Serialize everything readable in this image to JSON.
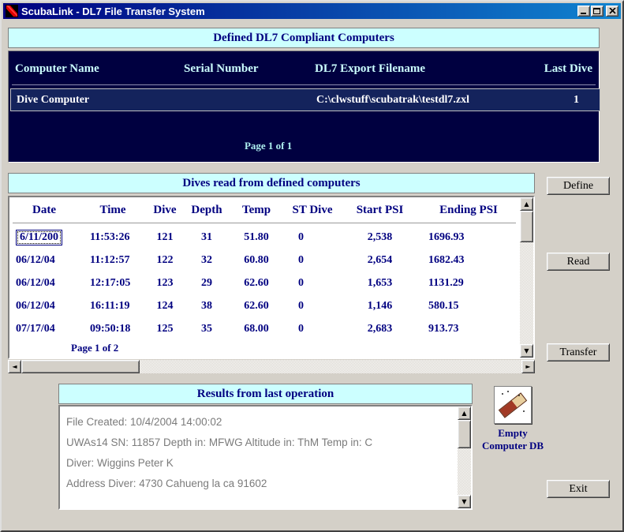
{
  "window": {
    "title": "ScubaLink - DL7 File Transfer System"
  },
  "icons": {
    "arrow_up": "▲",
    "arrow_down": "▼",
    "arrow_left": "◄",
    "arrow_right": "►"
  },
  "computers": {
    "header": "Defined DL7 Compliant Computers",
    "columns": [
      "Computer Name",
      "Serial Number",
      "DL7 Export Filename",
      "Last Dive"
    ],
    "row": {
      "name": "Dive Computer",
      "serial": "",
      "filename": "C:\\clwstuff\\scubatrak\\testdl7.zxl",
      "last_dive": "1"
    },
    "page_label": "Page 1 of 1"
  },
  "dives": {
    "header": "Dives read from defined computers",
    "columns": [
      "Date",
      "Time",
      "Dive",
      "Depth",
      "Temp",
      "ST Dive",
      "Start PSI",
      "Ending PSI"
    ],
    "rows": [
      [
        "6/11/200",
        "11:53:26",
        "121",
        "31",
        "51.80",
        "0",
        "2,538",
        "1696.93"
      ],
      [
        "06/12/04",
        "11:12:57",
        "122",
        "32",
        "60.80",
        "0",
        "2,654",
        "1682.43"
      ],
      [
        "06/12/04",
        "12:17:05",
        "123",
        "29",
        "62.60",
        "0",
        "1,653",
        "1131.29"
      ],
      [
        "06/12/04",
        "16:11:19",
        "124",
        "38",
        "62.60",
        "0",
        "1,146",
        "580.15"
      ],
      [
        "07/17/04",
        "09:50:18",
        "125",
        "35",
        "68.00",
        "0",
        "2,683",
        "913.73"
      ]
    ],
    "page_label": "Page 1 of 2"
  },
  "buttons": {
    "define": "Define",
    "read": "Read",
    "transfer": "Transfer",
    "exit": "Exit"
  },
  "results": {
    "header": "Results from last operation",
    "lines": [
      "File Created: 10/4/2004 14:00:02",
      "UWAs14 SN: 11857 Depth in: MFWG Altitude in: ThM Temp in: C",
      "Diver: Wiggins Peter K",
      "Address Diver: 4730 Cahueng  la ca 91602"
    ]
  },
  "empty_db": {
    "line1": "Empty",
    "line2": "Computer DB"
  },
  "colors": {
    "titlebar_start": "#000080",
    "titlebar_end": "#1084d0",
    "window_bg": "#d4d0c8",
    "band_bg": "#ccffff",
    "navy_text": "#000080",
    "panel_bg": "#000040",
    "selected_row_bg": "#14235c",
    "results_text": "#7b7b7b"
  }
}
